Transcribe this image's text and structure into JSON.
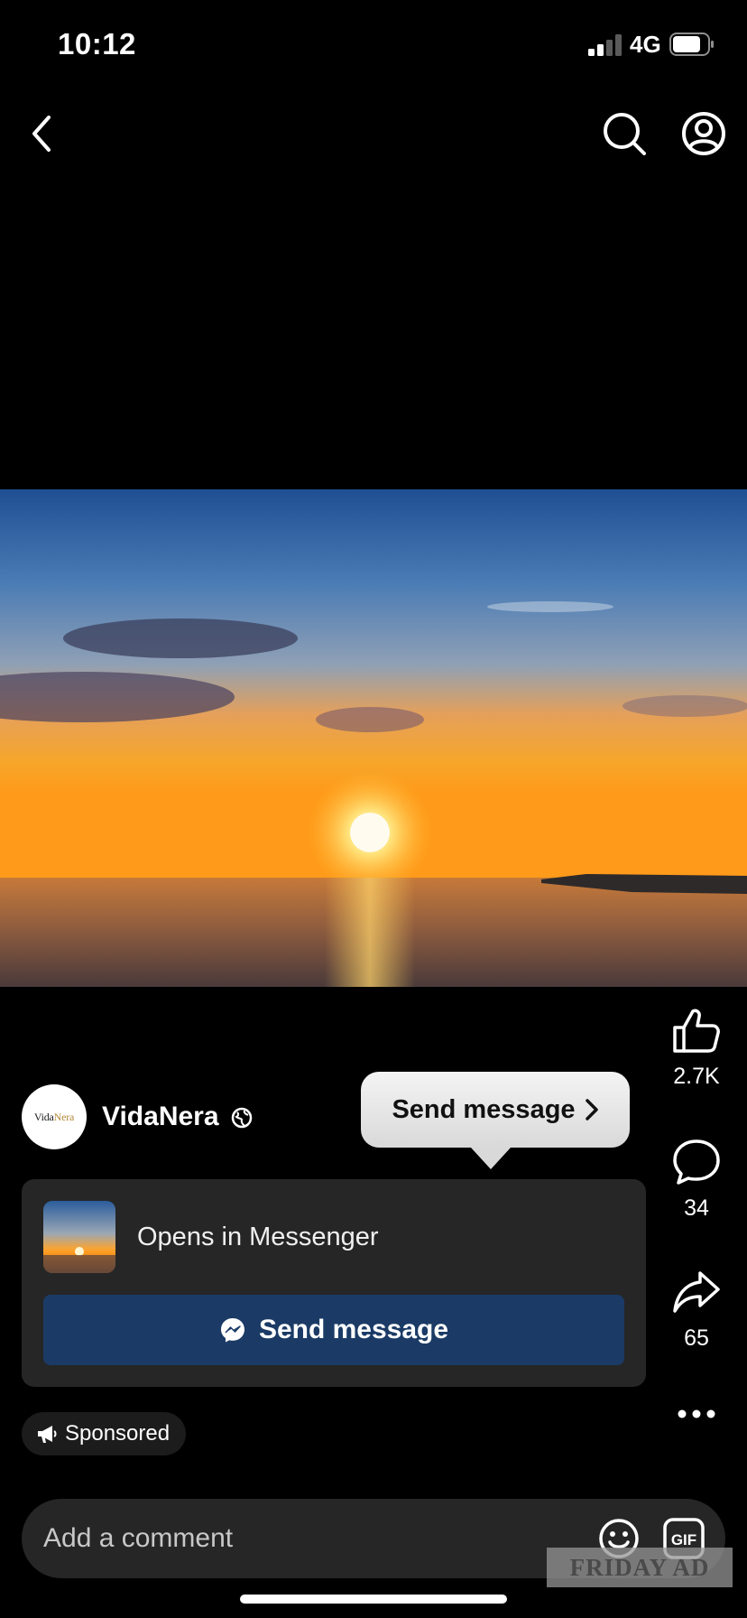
{
  "status_bar": {
    "time": "10:12",
    "network": "4G"
  },
  "nav": {
    "back_icon": "chevron-left-icon",
    "search_icon": "search-icon",
    "profile_icon": "profile-icon"
  },
  "actions": {
    "likes": "2.7K",
    "comments": "34",
    "shares": "65"
  },
  "advertiser": {
    "name": "VidaNera",
    "logo_text_a": "Vida",
    "logo_text_b": "Nera",
    "audience_icon": "globe-icon"
  },
  "tooltip": {
    "label": "Send message"
  },
  "cta": {
    "subtitle": "Opens in Messenger",
    "button_label": "Send message"
  },
  "sponsored": {
    "label": "Sponsored"
  },
  "comment": {
    "placeholder": "Add a comment"
  },
  "watermark": {
    "text": "FRIDAY AD"
  },
  "colors": {
    "background": "#000000",
    "card": "#262626",
    "cta_button": "#1b3b66",
    "text": "#ffffff"
  }
}
